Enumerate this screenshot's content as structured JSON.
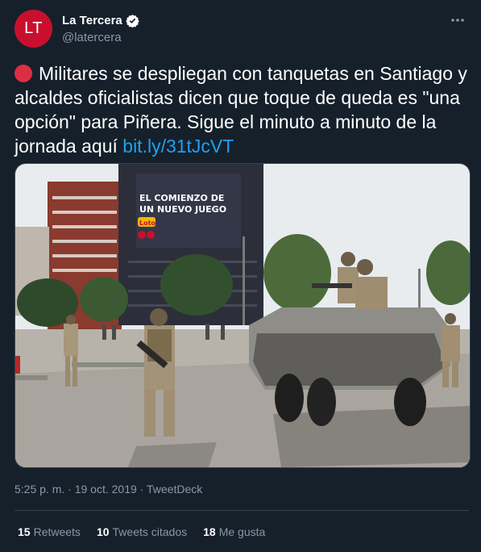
{
  "account": {
    "avatar_text": "LT",
    "display_name": "La Tercera",
    "handle": "@latercera",
    "brand_color": "#c8102e"
  },
  "tweet": {
    "text_main": "Militares se despliegan con tanquetas en Santiago y alcaldes oficialistas dicen que toque de queda es \"una opción\" para Piñera. Sigue el minuto a minuto de la jornada aquí ",
    "link_text": "bit.ly/31tJcVT",
    "emoji_icon": "red-circle-icon"
  },
  "media": {
    "billboard_line1": "EL COMIENZO DE",
    "billboard_line2": "UN NUEVO JUEGO",
    "billboard_brand": "Loto"
  },
  "meta": {
    "time": "5:25 p. m.",
    "separator": "·",
    "date": "19 oct. 2019",
    "source": "TweetDeck"
  },
  "stats": {
    "retweets_count": "15",
    "retweets_label": "Retweets",
    "quotes_count": "10",
    "quotes_label": "Tweets citados",
    "likes_count": "18",
    "likes_label": "Me gusta"
  },
  "colors": {
    "background": "#15202b",
    "muted": "#8899a6",
    "link": "#1da1f2",
    "divider": "#38444d"
  }
}
